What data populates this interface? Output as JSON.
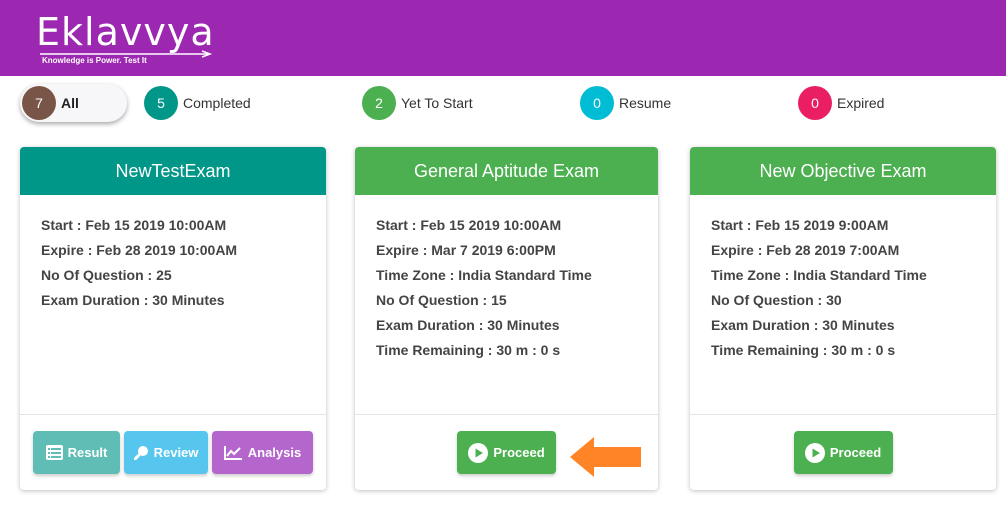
{
  "brand": {
    "name": "Eklavvya",
    "tagline": "Knowledge is Power. Test It"
  },
  "filters": [
    {
      "count": "7",
      "label": "All",
      "color": "#795548"
    },
    {
      "count": "5",
      "label": "Completed",
      "color": "#009688"
    },
    {
      "count": "2",
      "label": "Yet To Start",
      "color": "#4caf50"
    },
    {
      "count": "0",
      "label": "Resume",
      "color": "#00bcd4"
    },
    {
      "count": "0",
      "label": "Expired",
      "color": "#e91e63"
    }
  ],
  "exams": [
    {
      "title": "NewTestExam",
      "header_color": "#009688",
      "rows": [
        "Start : Feb 15 2019 10:00AM",
        "Expire : Feb 28 2019 10:00AM",
        "No Of Question : 25",
        "Exam Duration : 30 Minutes"
      ],
      "buttons": [
        {
          "label": "Result",
          "icon": "list-icon",
          "color": "#5fbdb5"
        },
        {
          "label": "Review",
          "icon": "magnifier-icon",
          "color": "#56c6ee"
        },
        {
          "label": "Analysis",
          "icon": "chart-icon",
          "color": "#b566cc"
        }
      ]
    },
    {
      "title": "General Aptitude Exam",
      "header_color": "#4caf50",
      "rows": [
        "Start : Feb 15 2019 10:00AM",
        "Expire : Mar 7 2019 6:00PM",
        "Time Zone : India Standard Time",
        "No Of Question : 15",
        "Exam Duration : 30 Minutes",
        "Time Remaining : 30 m : 0 s"
      ],
      "buttons": [
        {
          "label": "Proceed",
          "icon": "play-icon",
          "color": "#4caf50"
        }
      ]
    },
    {
      "title": "New Objective Exam",
      "header_color": "#4caf50",
      "rows": [
        "Start : Feb 15 2019 9:00AM",
        "Expire : Feb 28 2019 7:00AM",
        "Time Zone : India Standard Time",
        "No Of Question : 30",
        "Exam Duration : 30 Minutes",
        "Time Remaining : 30 m : 0 s"
      ],
      "buttons": [
        {
          "label": "Proceed",
          "icon": "play-icon",
          "color": "#4caf50"
        }
      ]
    }
  ],
  "annotation": {
    "icon": "arrow-left-icon",
    "color": "#ff8426"
  }
}
